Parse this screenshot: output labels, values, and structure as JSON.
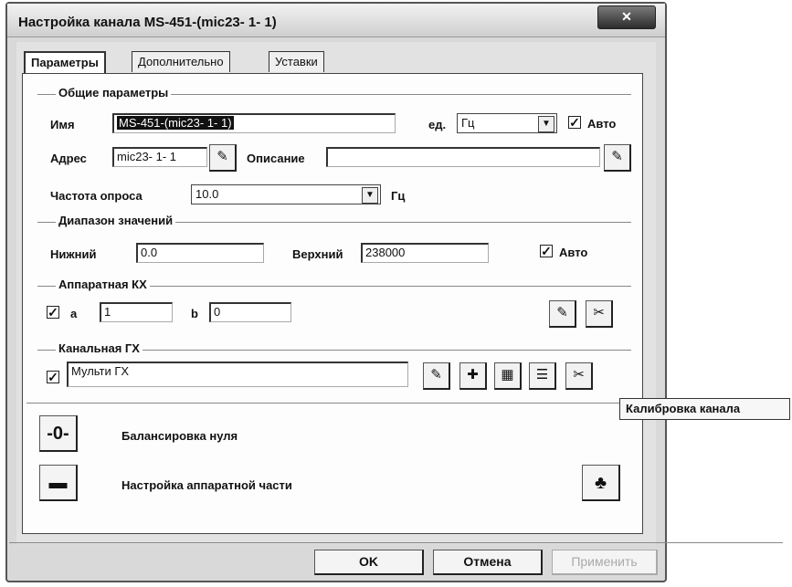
{
  "window": {
    "title": "Настройка канала MS-451-(mic23- 1- 1)",
    "close_glyph": "✕"
  },
  "tabs": [
    {
      "label": "Параметры",
      "active": true
    },
    {
      "label": "Дополнительно",
      "active": false
    },
    {
      "label": "Уставки",
      "active": false
    }
  ],
  "general": {
    "group_label": "Общие параметры",
    "name_label": "Имя",
    "name_value": "MS-451-(mic23- 1- 1)",
    "unit_label": "ед.",
    "unit_value": "Гц",
    "auto_label": "Авто",
    "auto_checked": true,
    "address_label": "Адрес",
    "address_value": "mic23- 1- 1",
    "description_label": "Описание",
    "description_value": "",
    "rate_label": "Частота опроса",
    "rate_value": "10.0",
    "rate_unit": "Гц"
  },
  "range": {
    "group_label": "Диапазон значений",
    "lower_label": "Нижний",
    "lower_value": "0.0",
    "upper_label": "Верхний",
    "upper_value": "238000",
    "auto_label": "Авто",
    "auto_checked": true
  },
  "hw_char": {
    "group_label": "Аппаратная КХ",
    "checked": true,
    "a_label": "a",
    "a_value": "1",
    "b_label": "b",
    "b_value": "0"
  },
  "ch_char": {
    "group_label": "Канальная ГХ",
    "checked": true,
    "value": "Мульти ГХ"
  },
  "actions": {
    "zero_balance_label": "Балансировка нуля",
    "hw_setup_label": "Настройка аппаратной части"
  },
  "tooltip": {
    "text": "Калибровка канала"
  },
  "buttons": {
    "ok": "OK",
    "cancel": "Отмена",
    "apply": "Применить"
  }
}
